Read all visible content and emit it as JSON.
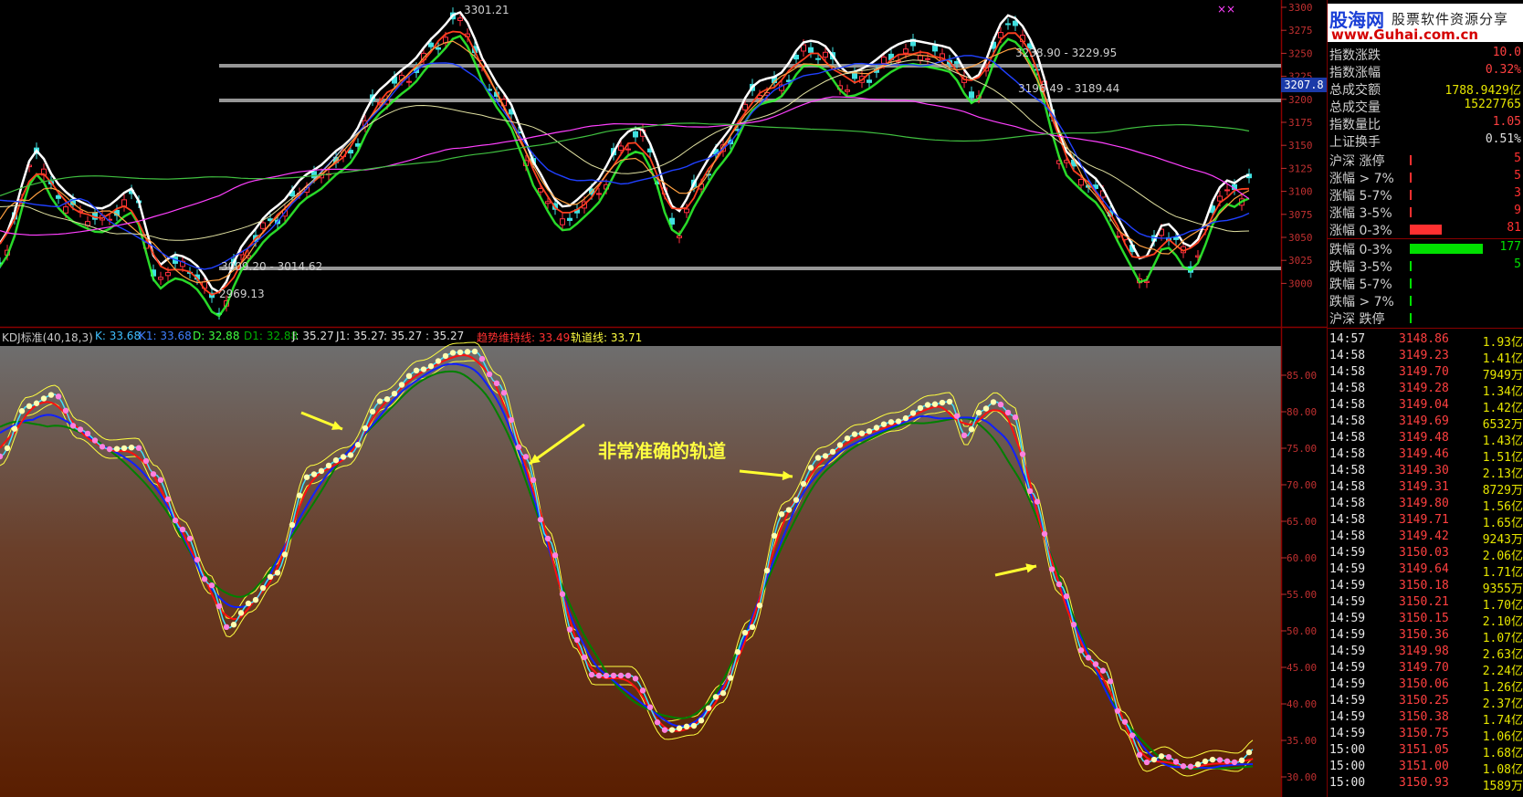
{
  "upper_axis": {
    "ticks": [
      "3300",
      "3275",
      "3250",
      "3225",
      "3200",
      "3175",
      "3150",
      "3125",
      "3100",
      "3075",
      "3050",
      "3025",
      "3000"
    ],
    "current_price": "3207.8"
  },
  "upper_labels": {
    "high": "3301.21",
    "low": "2969.13",
    "range_top": "3238.90 - 3229.95",
    "range_mid": "3196.49 - 3189.44",
    "range_low": "3009.20 - 3014.62"
  },
  "indicator_bar": {
    "name": "KDJ标准(40,18,3)",
    "k": "K: 33.68",
    "k1": "K1: 33.68",
    "d": "D: 32.88",
    "d1": "D1: 32.88",
    "j": "J: 35.27",
    "j1": "J1: 35.27",
    "extra": ": 35.27 : 35.27",
    "trend_line": "趋势维持线: 33.49",
    "track_line": "轨道线: 33.71"
  },
  "lower_axis": {
    "ticks": [
      "85.00",
      "80.00",
      "75.00",
      "70.00",
      "65.00",
      "60.00",
      "55.00",
      "50.00",
      "45.00",
      "40.00",
      "35.00",
      "30.00"
    ]
  },
  "annotation": "非常准确的轨道",
  "sidebar": {
    "brand_name": "股海网",
    "brand_slogan": "股票软件资源分享",
    "brand_url": "www.Guhai.com.cn",
    "stats": [
      {
        "label": "指数涨跌",
        "value": "10.0"
      },
      {
        "label": "指数涨幅",
        "value": "0.32%"
      },
      {
        "label": "总成交额",
        "value": "1788.9429亿"
      },
      {
        "label": "总成交量",
        "value": "15227765"
      },
      {
        "label": "指数量比",
        "value": "1.05"
      },
      {
        "label": "上证换手",
        "value": "0.51%"
      }
    ],
    "breadth": [
      {
        "label": "沪深 涨停",
        "value": "5",
        "bar": 0.02,
        "color": "#ff3030"
      },
      {
        "label": "涨幅 > 7%",
        "value": "5",
        "bar": 0.01,
        "color": "#ff3030"
      },
      {
        "label": "涨幅 5-7%",
        "value": "3",
        "bar": 0.01,
        "color": "#ff3030"
      },
      {
        "label": "涨幅 3-5%",
        "value": "9",
        "bar": 0.03,
        "color": "#ff3030"
      },
      {
        "label": "涨幅 0-3%",
        "value": "81",
        "bar": 0.44,
        "color": "#ff3030"
      },
      {
        "label": "跌幅 0-3%",
        "value": "177",
        "bar": 1.0,
        "color": "#00e000"
      },
      {
        "label": "跌幅 3-5%",
        "value": "5",
        "bar": 0.02,
        "color": "#00e000"
      },
      {
        "label": "跌幅 5-7%",
        "value": "",
        "bar": 0.01,
        "color": "#00e000"
      },
      {
        "label": "跌幅 > 7%",
        "value": "",
        "bar": 0.01,
        "color": "#00e000"
      },
      {
        "label": "沪深 跌停",
        "value": "",
        "bar": 0.01,
        "color": "#00e000"
      }
    ],
    "ticks": [
      [
        "14:57",
        "3148.86",
        "1.93亿"
      ],
      [
        "14:58",
        "3149.23",
        "1.41亿"
      ],
      [
        "14:58",
        "3149.70",
        "7949万"
      ],
      [
        "14:58",
        "3149.28",
        "1.34亿"
      ],
      [
        "14:58",
        "3149.04",
        "1.42亿"
      ],
      [
        "14:58",
        "3149.69",
        "6532万"
      ],
      [
        "14:58",
        "3149.48",
        "1.43亿"
      ],
      [
        "14:58",
        "3149.46",
        "1.51亿"
      ],
      [
        "14:58",
        "3149.30",
        "2.13亿"
      ],
      [
        "14:58",
        "3149.31",
        "8729万"
      ],
      [
        "14:58",
        "3149.80",
        "1.56亿"
      ],
      [
        "14:58",
        "3149.71",
        "1.65亿"
      ],
      [
        "14:58",
        "3149.42",
        "9243万"
      ],
      [
        "14:59",
        "3150.03",
        "2.06亿"
      ],
      [
        "14:59",
        "3149.64",
        "1.71亿"
      ],
      [
        "14:59",
        "3150.18",
        "9355万"
      ],
      [
        "14:59",
        "3150.21",
        "1.70亿"
      ],
      [
        "14:59",
        "3150.15",
        "2.10亿"
      ],
      [
        "14:59",
        "3150.36",
        "1.07亿"
      ],
      [
        "14:59",
        "3149.98",
        "2.63亿"
      ],
      [
        "14:59",
        "3149.70",
        "2.24亿"
      ],
      [
        "14:59",
        "3150.06",
        "1.26亿"
      ],
      [
        "14:59",
        "3150.25",
        "2.37亿"
      ],
      [
        "14:59",
        "3150.38",
        "1.74亿"
      ],
      [
        "14:59",
        "3150.75",
        "1.06亿"
      ],
      [
        "15:00",
        "3151.05",
        "1.68亿"
      ],
      [
        "15:00",
        "3151.00",
        "1.08亿"
      ],
      [
        "15:00",
        "3150.93",
        "1589万"
      ]
    ]
  }
}
